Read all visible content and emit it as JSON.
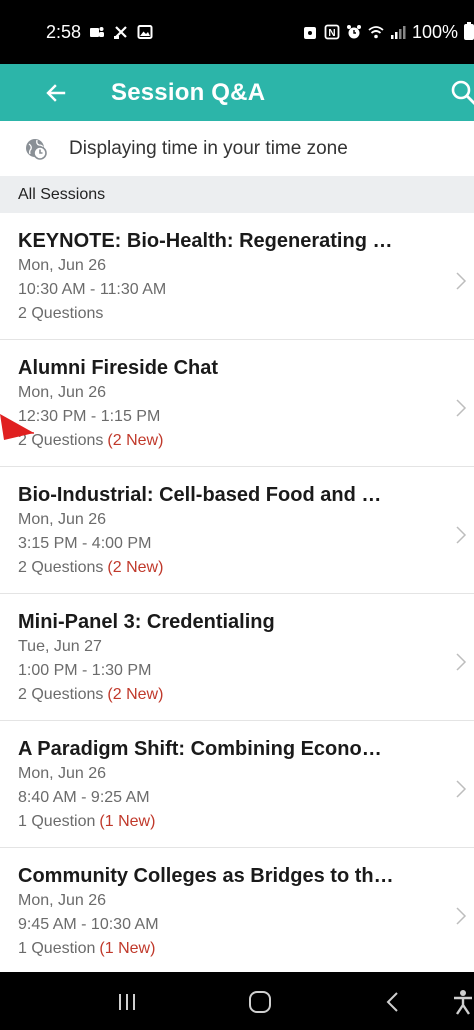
{
  "status_bar": {
    "time": "2:58",
    "battery": "100%"
  },
  "app_bar": {
    "title": "Session Q&A"
  },
  "timezone": {
    "text": "Displaying time in your time zone"
  },
  "section": {
    "header": "All Sessions"
  },
  "sessions": [
    {
      "title": "KEYNOTE: Bio-Health: Regenerating …",
      "date": "Mon, Jun 26",
      "time": "10:30 AM - 11:30 AM",
      "count": "2 Questions",
      "new": ""
    },
    {
      "title": "Alumni Fireside Chat",
      "date": "Mon, Jun 26",
      "time": "12:30 PM - 1:15 PM",
      "count": "2 Questions",
      "new": "(2 New)"
    },
    {
      "title": "Bio-Industrial: Cell-based Food and …",
      "date": "Mon, Jun 26",
      "time": "3:15 PM - 4:00 PM",
      "count": "2 Questions",
      "new": "(2 New)"
    },
    {
      "title": "Mini-Panel 3: Credentialing",
      "date": "Tue, Jun 27",
      "time": "1:00 PM - 1:30 PM",
      "count": "2 Questions",
      "new": "(2 New)"
    },
    {
      "title": "A Paradigm Shift: Combining Econo…",
      "date": "Mon, Jun 26",
      "time": "8:40 AM - 9:25 AM",
      "count": "1 Question",
      "new": "(1 New)"
    },
    {
      "title": "Community Colleges as Bridges to th…",
      "date": "Mon, Jun 26",
      "time": "9:45 AM - 10:30 AM",
      "count": "1 Question",
      "new": "(1 New)"
    }
  ],
  "colors": {
    "app_bar": "#2cb5a9",
    "new_badge": "#c0392b",
    "annotation": "#e02020"
  },
  "icons": {
    "back": "arrow-left-icon",
    "search": "search-icon",
    "timezone": "globe-clock-icon",
    "chevron": "chevron-right-icon"
  }
}
